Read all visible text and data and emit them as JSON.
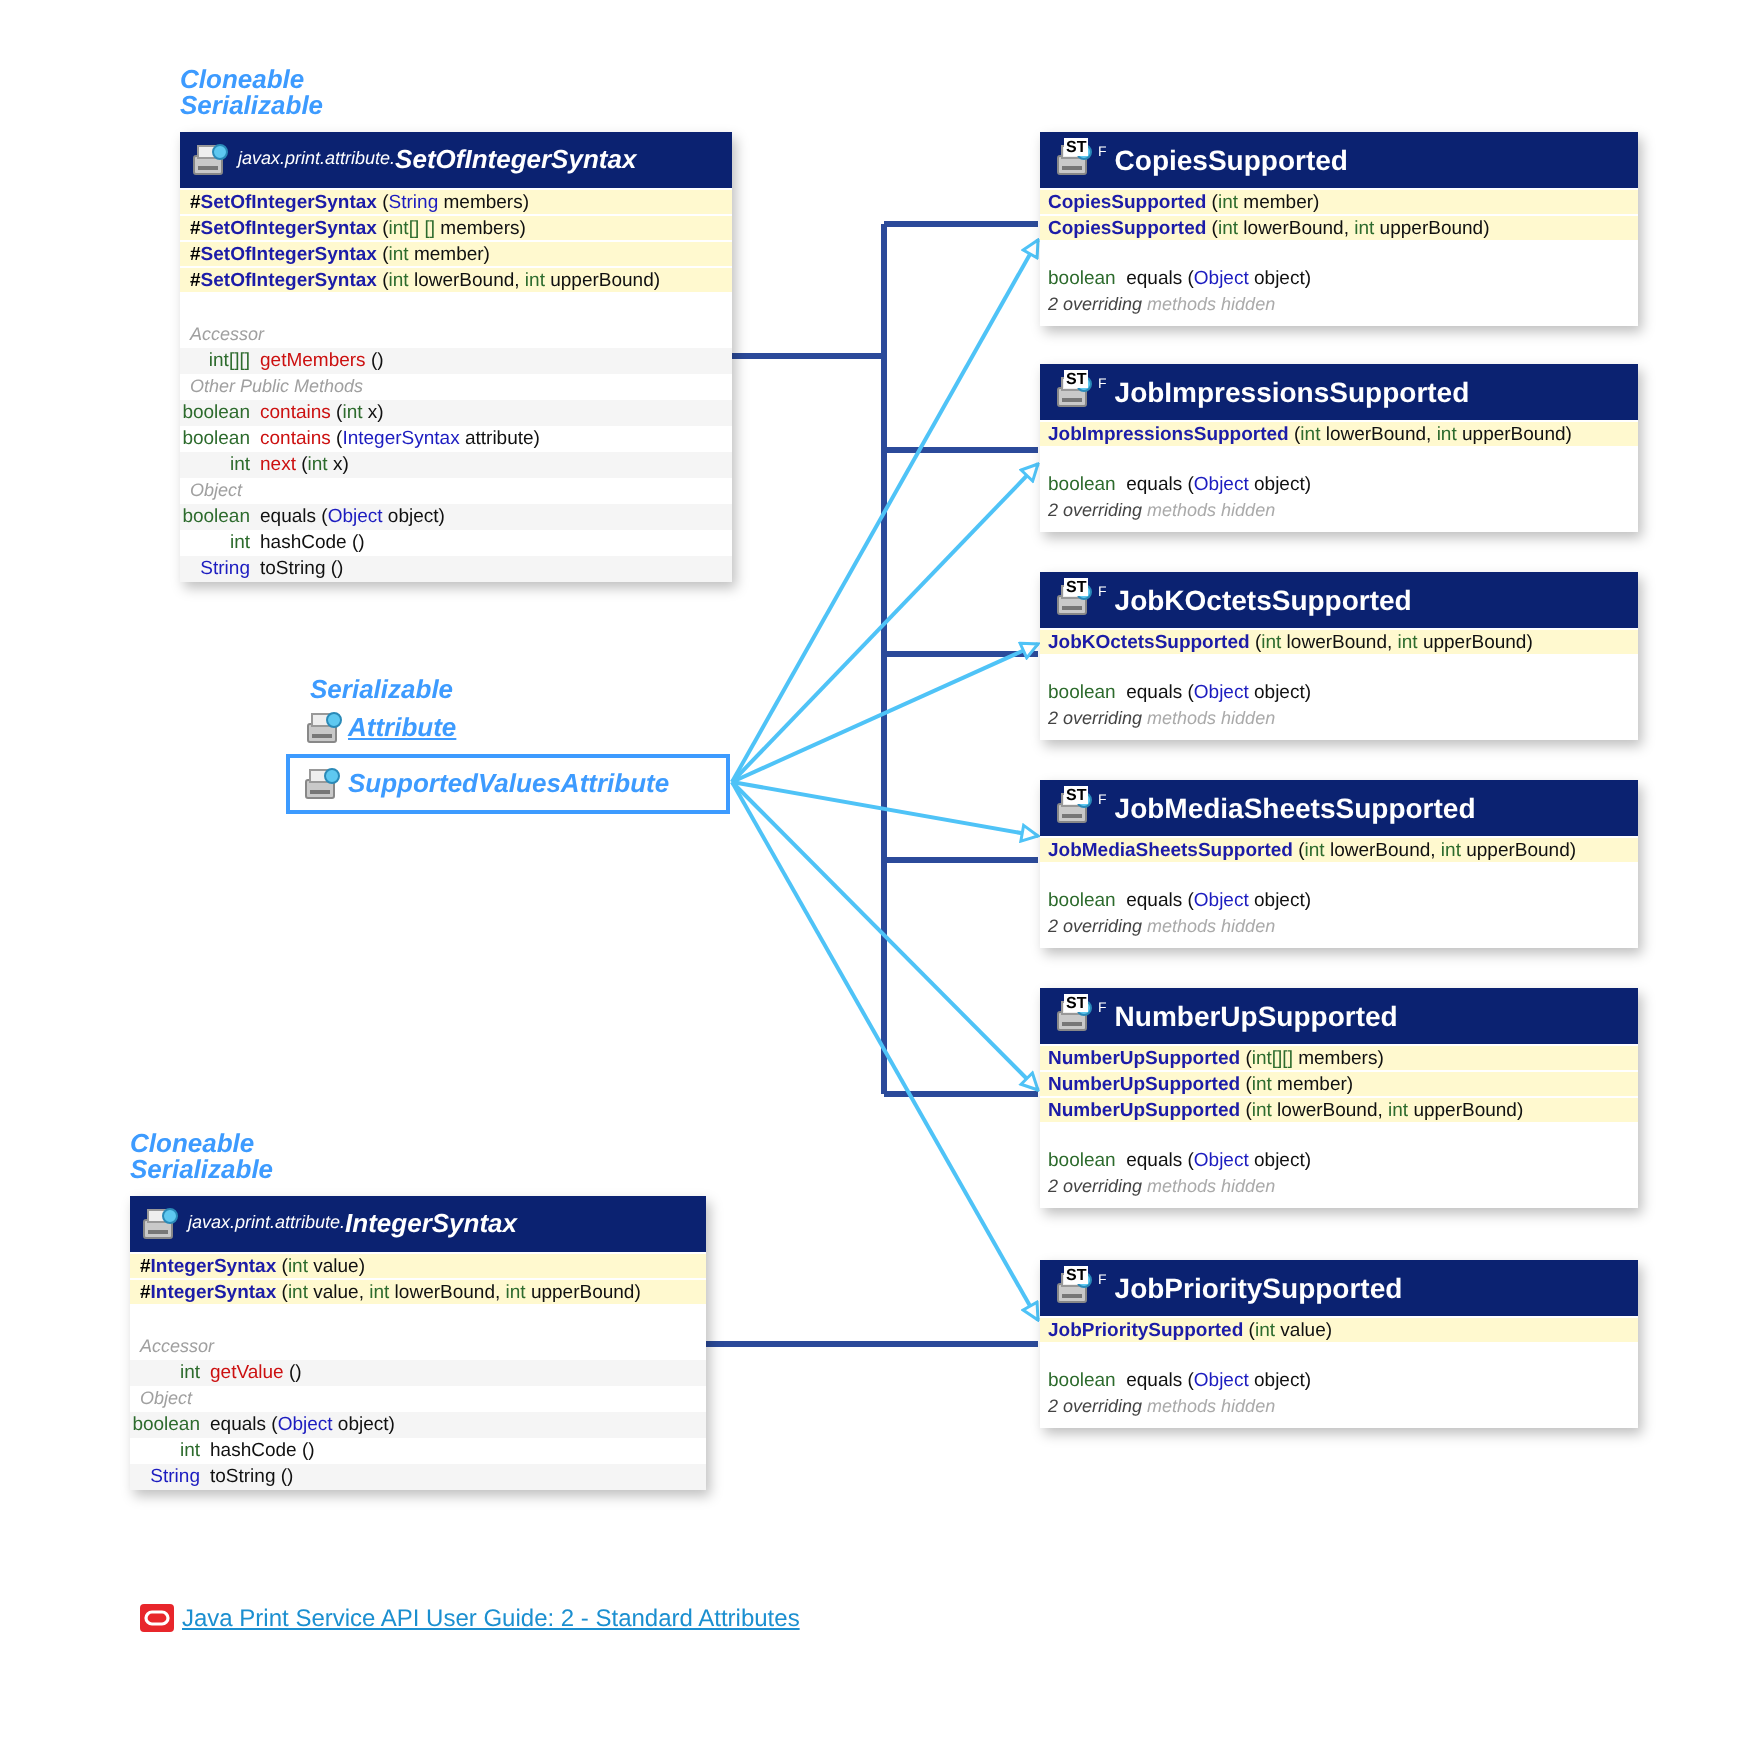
{
  "classes": [
    {
      "interfaces": [
        "Cloneable",
        "Serializable"
      ],
      "package": "javax.print.attribute.",
      "name": "SetOfIntegerSyntax",
      "constructors": [
        {
          "visibility": "#",
          "parts": [
            {
              "text": "SetOfIntegerSyntax",
              "kind": "ctor"
            },
            {
              "text": " (",
              "kind": "plain"
            },
            {
              "text": "String",
              "kind": "class"
            },
            {
              "text": " members)",
              "kind": "plain"
            }
          ]
        },
        {
          "visibility": "#",
          "parts": [
            {
              "text": "SetOfIntegerSyntax",
              "kind": "ctor"
            },
            {
              "text": " (",
              "kind": "plain"
            },
            {
              "text": "int[] []",
              "kind": "prim"
            },
            {
              "text": " members)",
              "kind": "plain"
            }
          ]
        },
        {
          "visibility": "#",
          "parts": [
            {
              "text": "SetOfIntegerSyntax",
              "kind": "ctor"
            },
            {
              "text": " (",
              "kind": "plain"
            },
            {
              "text": "int",
              "kind": "prim"
            },
            {
              "text": " member)",
              "kind": "plain"
            }
          ]
        },
        {
          "visibility": "#",
          "parts": [
            {
              "text": "SetOfIntegerSyntax",
              "kind": "ctor"
            },
            {
              "text": " (",
              "kind": "plain"
            },
            {
              "text": "int",
              "kind": "prim"
            },
            {
              "text": " lowerBound, ",
              "kind": "plain"
            },
            {
              "text": "int",
              "kind": "prim"
            },
            {
              "text": " upperBound)",
              "kind": "plain"
            }
          ]
        }
      ],
      "sections": [
        {
          "label": "Accessor",
          "rows": [
            {
              "type": {
                "text": "int[][]",
                "kind": "prim"
              },
              "parts": [
                {
                  "text": "getMembers",
                  "kind": "method"
                },
                {
                  "text": " ()",
                  "kind": "plain"
                }
              ]
            }
          ]
        },
        {
          "label": "Other Public Methods",
          "rows": [
            {
              "type": {
                "text": "boolean",
                "kind": "prim"
              },
              "parts": [
                {
                  "text": "contains",
                  "kind": "method"
                },
                {
                  "text": " (",
                  "kind": "plain"
                },
                {
                  "text": "int",
                  "kind": "prim"
                },
                {
                  "text": " x)",
                  "kind": "plain"
                }
              ]
            },
            {
              "type": {
                "text": "boolean",
                "kind": "prim"
              },
              "parts": [
                {
                  "text": "contains",
                  "kind": "method"
                },
                {
                  "text": " (",
                  "kind": "plain"
                },
                {
                  "text": "IntegerSyntax",
                  "kind": "class"
                },
                {
                  "text": " attribute)",
                  "kind": "plain"
                }
              ]
            },
            {
              "type": {
                "text": "int",
                "kind": "prim"
              },
              "parts": [
                {
                  "text": "next",
                  "kind": "method"
                },
                {
                  "text": " (",
                  "kind": "plain"
                },
                {
                  "text": "int",
                  "kind": "prim"
                },
                {
                  "text": " x)",
                  "kind": "plain"
                }
              ]
            }
          ]
        },
        {
          "label": "Object",
          "rows": [
            {
              "type": {
                "text": "boolean",
                "kind": "prim"
              },
              "parts": [
                {
                  "text": "equals",
                  "kind": "plain"
                },
                {
                  "text": " (",
                  "kind": "plain"
                },
                {
                  "text": "Object",
                  "kind": "class"
                },
                {
                  "text": " object)",
                  "kind": "plain"
                }
              ]
            },
            {
              "type": {
                "text": "int",
                "kind": "prim"
              },
              "parts": [
                {
                  "text": "hashCode",
                  "kind": "plain"
                },
                {
                  "text": " ()",
                  "kind": "plain"
                }
              ]
            },
            {
              "type": {
                "text": "String",
                "kind": "class"
              },
              "parts": [
                {
                  "text": "toString",
                  "kind": "plain"
                },
                {
                  "text": " ()",
                  "kind": "plain"
                }
              ]
            }
          ]
        }
      ]
    },
    {
      "interfaces": [
        "Cloneable",
        "Serializable"
      ],
      "package": "javax.print.attribute.",
      "name": "IntegerSyntax",
      "constructors": [
        {
          "visibility": "#",
          "parts": [
            {
              "text": "IntegerSyntax",
              "kind": "ctor"
            },
            {
              "text": " (",
              "kind": "plain"
            },
            {
              "text": "int",
              "kind": "prim"
            },
            {
              "text": " value)",
              "kind": "plain"
            }
          ]
        },
        {
          "visibility": "#",
          "parts": [
            {
              "text": "IntegerSyntax",
              "kind": "ctor"
            },
            {
              "text": " (",
              "kind": "plain"
            },
            {
              "text": "int",
              "kind": "prim"
            },
            {
              "text": " value, ",
              "kind": "plain"
            },
            {
              "text": "int",
              "kind": "prim"
            },
            {
              "text": " lowerBound, ",
              "kind": "plain"
            },
            {
              "text": "int",
              "kind": "prim"
            },
            {
              "text": " upperBound)",
              "kind": "plain"
            }
          ]
        }
      ],
      "sections": [
        {
          "label": "Accessor",
          "rows": [
            {
              "type": {
                "text": "int",
                "kind": "prim"
              },
              "parts": [
                {
                  "text": "getValue",
                  "kind": "method"
                },
                {
                  "text": " ()",
                  "kind": "plain"
                }
              ]
            }
          ]
        },
        {
          "label": "Object",
          "rows": [
            {
              "type": {
                "text": "boolean",
                "kind": "prim"
              },
              "parts": [
                {
                  "text": "equals",
                  "kind": "plain"
                },
                {
                  "text": " (",
                  "kind": "plain"
                },
                {
                  "text": "Object",
                  "kind": "class"
                },
                {
                  "text": " object)",
                  "kind": "plain"
                }
              ]
            },
            {
              "type": {
                "text": "int",
                "kind": "prim"
              },
              "parts": [
                {
                  "text": "hashCode",
                  "kind": "plain"
                },
                {
                  "text": " ()",
                  "kind": "plain"
                }
              ]
            },
            {
              "type": {
                "text": "String",
                "kind": "class"
              },
              "parts": [
                {
                  "text": "toString",
                  "kind": "plain"
                },
                {
                  "text": " ()",
                  "kind": "plain"
                }
              ]
            }
          ]
        }
      ]
    }
  ],
  "attribute": {
    "interface": "Serializable",
    "parent": "Attribute",
    "name": "SupportedValuesAttribute"
  },
  "subclasses": [
    {
      "badge": "ST",
      "modifier": "F",
      "name": "CopiesSupported",
      "constructors": [
        {
          "parts": [
            {
              "text": "CopiesSupported",
              "kind": "ctor"
            },
            {
              "text": " (",
              "kind": "plain"
            },
            {
              "text": "int",
              "kind": "prim"
            },
            {
              "text": " member)",
              "kind": "plain"
            }
          ]
        },
        {
          "parts": [
            {
              "text": "CopiesSupported",
              "kind": "ctor"
            },
            {
              "text": " (",
              "kind": "plain"
            },
            {
              "text": "int",
              "kind": "prim"
            },
            {
              "text": " lowerBound, ",
              "kind": "plain"
            },
            {
              "text": "int",
              "kind": "prim"
            },
            {
              "text": " upperBound)",
              "kind": "plain"
            }
          ]
        }
      ],
      "methods": [
        {
          "parts": [
            {
              "text": "boolean",
              "kind": "prim"
            },
            {
              "text": "  equals (",
              "kind": "plain"
            },
            {
              "text": "Object",
              "kind": "class"
            },
            {
              "text": " object)",
              "kind": "plain"
            }
          ]
        }
      ],
      "note": [
        {
          "text": "2 overriding",
          "kind": "strong"
        },
        {
          "text": " methods hidden",
          "kind": "weak"
        }
      ]
    },
    {
      "badge": "ST",
      "modifier": "F",
      "name": "JobImpressionsSupported",
      "constructors": [
        {
          "parts": [
            {
              "text": "JobImpressionsSupported",
              "kind": "ctor"
            },
            {
              "text": " (",
              "kind": "plain"
            },
            {
              "text": "int",
              "kind": "prim"
            },
            {
              "text": " lowerBound, ",
              "kind": "plain"
            },
            {
              "text": "int",
              "kind": "prim"
            },
            {
              "text": " upperBound)",
              "kind": "plain"
            }
          ]
        }
      ],
      "methods": [
        {
          "parts": [
            {
              "text": "boolean",
              "kind": "prim"
            },
            {
              "text": "  equals (",
              "kind": "plain"
            },
            {
              "text": "Object",
              "kind": "class"
            },
            {
              "text": " object)",
              "kind": "plain"
            }
          ]
        }
      ],
      "note": [
        {
          "text": "2 overriding",
          "kind": "strong"
        },
        {
          "text": " methods hidden",
          "kind": "weak"
        }
      ]
    },
    {
      "badge": "ST",
      "modifier": "F",
      "name": "JobKOctetsSupported",
      "constructors": [
        {
          "parts": [
            {
              "text": "JobKOctetsSupported",
              "kind": "ctor"
            },
            {
              "text": " (",
              "kind": "plain"
            },
            {
              "text": "int",
              "kind": "prim"
            },
            {
              "text": " lowerBound, ",
              "kind": "plain"
            },
            {
              "text": "int",
              "kind": "prim"
            },
            {
              "text": " upperBound)",
              "kind": "plain"
            }
          ]
        }
      ],
      "methods": [
        {
          "parts": [
            {
              "text": "boolean",
              "kind": "prim"
            },
            {
              "text": "  equals (",
              "kind": "plain"
            },
            {
              "text": "Object",
              "kind": "class"
            },
            {
              "text": " object)",
              "kind": "plain"
            }
          ]
        }
      ],
      "note": [
        {
          "text": "2 overriding",
          "kind": "strong"
        },
        {
          "text": " methods hidden",
          "kind": "weak"
        }
      ]
    },
    {
      "badge": "ST",
      "modifier": "F",
      "name": "JobMediaSheetsSupported",
      "constructors": [
        {
          "parts": [
            {
              "text": "JobMediaSheetsSupported",
              "kind": "ctor"
            },
            {
              "text": " (",
              "kind": "plain"
            },
            {
              "text": "int",
              "kind": "prim"
            },
            {
              "text": " lowerBound, ",
              "kind": "plain"
            },
            {
              "text": "int",
              "kind": "prim"
            },
            {
              "text": " upperBound)",
              "kind": "plain"
            }
          ]
        }
      ],
      "methods": [
        {
          "parts": [
            {
              "text": "boolean",
              "kind": "prim"
            },
            {
              "text": "  equals (",
              "kind": "plain"
            },
            {
              "text": "Object",
              "kind": "class"
            },
            {
              "text": " object)",
              "kind": "plain"
            }
          ]
        }
      ],
      "note": [
        {
          "text": "2 overriding",
          "kind": "strong"
        },
        {
          "text": " methods hidden",
          "kind": "weak"
        }
      ]
    },
    {
      "badge": "ST",
      "modifier": "F",
      "name": "NumberUpSupported",
      "constructors": [
        {
          "parts": [
            {
              "text": "NumberUpSupported",
              "kind": "ctor"
            },
            {
              "text": " (",
              "kind": "plain"
            },
            {
              "text": "int[][]",
              "kind": "prim"
            },
            {
              "text": " members)",
              "kind": "plain"
            }
          ]
        },
        {
          "parts": [
            {
              "text": "NumberUpSupported",
              "kind": "ctor"
            },
            {
              "text": " (",
              "kind": "plain"
            },
            {
              "text": "int",
              "kind": "prim"
            },
            {
              "text": " member)",
              "kind": "plain"
            }
          ]
        },
        {
          "parts": [
            {
              "text": "NumberUpSupported",
              "kind": "ctor"
            },
            {
              "text": " (",
              "kind": "plain"
            },
            {
              "text": "int",
              "kind": "prim"
            },
            {
              "text": " lowerBound, ",
              "kind": "plain"
            },
            {
              "text": "int",
              "kind": "prim"
            },
            {
              "text": " upperBound)",
              "kind": "plain"
            }
          ]
        }
      ],
      "methods": [
        {
          "parts": [
            {
              "text": "boolean",
              "kind": "prim"
            },
            {
              "text": "  equals (",
              "kind": "plain"
            },
            {
              "text": "Object",
              "kind": "class"
            },
            {
              "text": " object)",
              "kind": "plain"
            }
          ]
        }
      ],
      "note": [
        {
          "text": "2 overriding",
          "kind": "strong"
        },
        {
          "text": " methods hidden",
          "kind": "weak"
        }
      ]
    },
    {
      "badge": "ST",
      "modifier": "F",
      "name": "JobPrioritySupported",
      "constructors": [
        {
          "parts": [
            {
              "text": "JobPrioritySupported",
              "kind": "ctor"
            },
            {
              "text": " (",
              "kind": "plain"
            },
            {
              "text": "int",
              "kind": "prim"
            },
            {
              "text": " value)",
              "kind": "plain"
            }
          ]
        }
      ],
      "methods": [
        {
          "parts": [
            {
              "text": "boolean",
              "kind": "prim"
            },
            {
              "text": "  equals (",
              "kind": "plain"
            },
            {
              "text": "Object",
              "kind": "class"
            },
            {
              "text": " object)",
              "kind": "plain"
            }
          ]
        }
      ],
      "note": [
        {
          "text": "2 overriding",
          "kind": "strong"
        },
        {
          "text": " methods hidden",
          "kind": "weak"
        }
      ]
    }
  ],
  "link": {
    "text": "Java Print Service API User Guide: 2 - Standard Attributes"
  }
}
